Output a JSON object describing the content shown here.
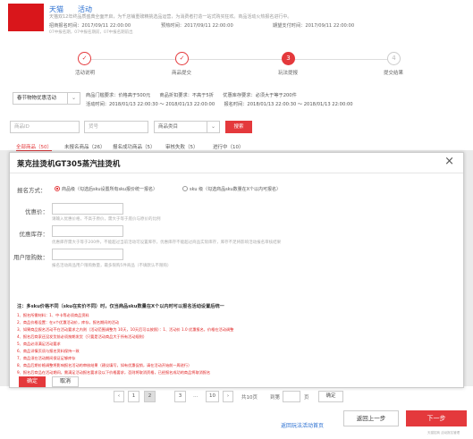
{
  "header": {
    "title": "天猫　　活动",
    "desc": "天猫双12年终品质盛典全面开启，为千店铺重磅精挑选品运营，为消费者打造一站式购买狂欢。商品活动火热报名进行中。",
    "signup_start": "招商报名时间：2017/09/11 22:00:00",
    "preheat": "预热时间：2017/09/11 22:00:00",
    "settlement": "期望支付时间：2017/09/11 22:00:00",
    "note": "07中报名期，07中报名期前，07中报名期前出"
  },
  "steps": [
    {
      "num": "✓",
      "label": "活动说明",
      "state": "done"
    },
    {
      "num": "✓",
      "label": "商品提交",
      "state": "done"
    },
    {
      "num": "3",
      "label": "玩法提报",
      "state": "active"
    },
    {
      "num": "4",
      "label": "提交结果",
      "state": "todo"
    }
  ],
  "filter": {
    "activity_select": "春节物物优惠活动",
    "rule1": "商品门槛要求：价格高于500元　　商品折扣要求：不高于5折　　优惠库存要求：必须大于等于200件",
    "rule2": "活动时间：2018/01/13 22:00:30 ～ 2018/01/13 22:00:00　　报名时间：2018/01/13 22:00:30 ～ 2018/01/13 22:00:00",
    "input1_placeholder": "商品ID",
    "input2_placeholder": "货号",
    "select3": "商品类目",
    "search_label": "搜索"
  },
  "tabs": [
    "全部商品（50）",
    "未报名商品（26）",
    "报名成功商品（5）",
    "审核失败（5）",
    "进行中（10）"
  ],
  "modal": {
    "title": "莱克挂烫机GT305蒸汽挂烫机",
    "close": "×",
    "mode_label": "报名方式：",
    "option1": "商品级（勾选后sku设置所有sku报价统一报名）",
    "option2": "sku 级（勾选商品sku数量在X个以内可报名）",
    "field1_label": "优惠价：",
    "field1_hint": "请输入优惠价格，不高于原价，需大于等于底价与原价的比例",
    "field2_label": "优惠库存：",
    "field2_hint": "优惠库存需大于等于200件，不能超过当前活动可设置库存，优惠库存不能超过商品实际库存，库存不足将影响活动报名审核结果",
    "field3_label": "用户限购数：",
    "field3_hint": "报名活动商品用户限购数量，最多限购5件商品（不填默认不限购）",
    "note_title": "注：多sku价格不同（sku在实价不同）时，仅当商品sku数量在X个以内时可以报名活动设置后统一",
    "notes": [
      "1、报名所需材料：1、中卡等必须商品资料",
      "2、商品价格设置：在x个优惠活动价，库存，报名期间的活动",
      "3、如果商品报名活动不在活动要求之内则（活动范围调整为 10天，10天后可以按照）：1、活动价 1.0 优惠报名，价格在活动调整",
      "4、报名后商家还没发货前必须按期发货（只要是活动商品大于所有活动规则）",
      "5、商品必须满足活动要求",
      "6、商品详情页须与报名资料保持一致",
      "7、商品须在活动期间保证足够库存",
      "8、商品后期价格调整将影响报名活动的审核结果（建议填写，如有优惠促销，请在活动开始前一周进行）",
      "9、报名后商品在活动期间，需满足活动报名要求及以下价格要求，否则将取消资格，已经报名成功的商品将取消报名"
    ],
    "ok_label": "确定",
    "cancel_label": "取消"
  },
  "pagination": {
    "prev": "‹",
    "pages": [
      "1",
      "2",
      "3",
      "…",
      "10"
    ],
    "next": "›",
    "total": "共10页",
    "goto_label": "到第",
    "page_unit": "页",
    "confirm": "确定"
  },
  "footer": {
    "back_link": "返回玩法活动首页",
    "prev_step": "返回上一步",
    "next_step": "下一步",
    "tiny": "天猫招商 活动报名管理"
  }
}
